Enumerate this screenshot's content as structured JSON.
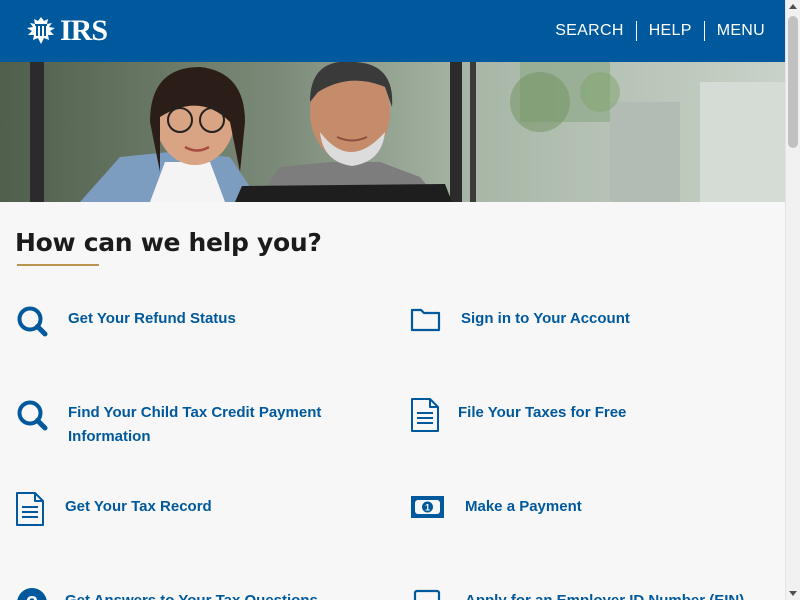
{
  "header": {
    "logo_text": "IRS",
    "nav": [
      "SEARCH",
      "HELP",
      "MENU"
    ]
  },
  "hero": {
    "icon": "photo-two-people-at-laptop"
  },
  "main": {
    "heading": "How can we help you?",
    "links": [
      {
        "label": "Get Your Refund Status",
        "icon": "search-icon"
      },
      {
        "label": "Sign in to Your Account",
        "icon": "folder-icon"
      },
      {
        "label": "Find Your Child Tax Credit Payment Information",
        "icon": "search-icon"
      },
      {
        "label": "File Your Taxes for Free",
        "icon": "document-icon"
      },
      {
        "label": "Get Your Tax Record",
        "icon": "document-icon"
      },
      {
        "label": "Make a Payment",
        "icon": "money-icon"
      },
      {
        "label": "Get Answers to Your Tax Questions",
        "icon": "question-icon"
      },
      {
        "label": "Apply for an Employer ID Number (EIN)",
        "icon": "laptop-icon"
      }
    ]
  },
  "colors": {
    "brand_blue": "#00599c",
    "accent_gold": "#b8964f",
    "heading": "#1b1b1b",
    "background": "#f7f7f7"
  }
}
